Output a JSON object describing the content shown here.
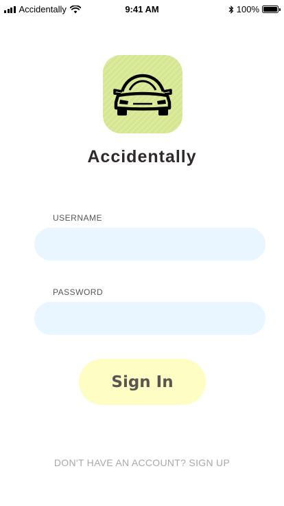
{
  "status_bar": {
    "carrier": "Accidentally",
    "time": "9:41 AM",
    "battery": "100%",
    "icons": [
      "signal-icon",
      "wifi-icon",
      "bluetooth-icon",
      "battery-icon"
    ]
  },
  "app": {
    "name": "Accidentally",
    "icon": "car-icon",
    "icon_color": "#d5e690"
  },
  "form": {
    "username_label": "USERNAME",
    "username_value": "",
    "password_label": "PASSWORD",
    "password_value": "",
    "field_color": "#eaf6ff"
  },
  "actions": {
    "signin_label": "Sign In",
    "signin_color": "#fdfdc4",
    "signup_link": "DON'T HAVE AN ACCOUNT? SIGN UP"
  }
}
